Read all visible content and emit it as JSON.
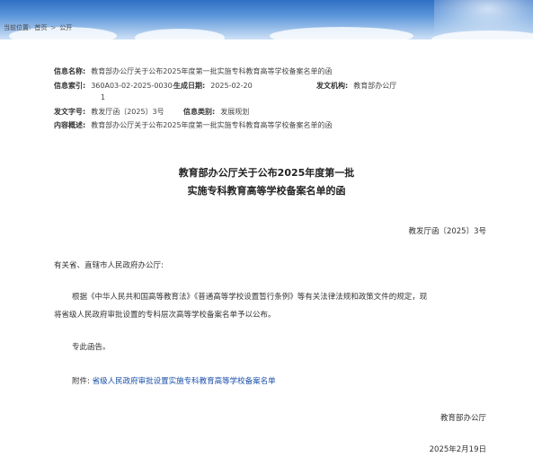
{
  "breadcrumb": {
    "label": "当前位置:",
    "home": "首页",
    "separator": ">",
    "current": "公开"
  },
  "meta": {
    "name_label": "信息名称:",
    "name_value": "教育部办公厅关于公布2025年度第一批实施专科教育高等学校备案名单的函",
    "index_label": "信息索引:",
    "index_value": "360A03-02-2025-0030-",
    "index_value_cont": "1",
    "date_label": "生成日期:",
    "date_value": "2025-02-20",
    "org_label": "发文机构:",
    "org_value": "教育部办公厅",
    "docnum_label": "发文字号:",
    "docnum_value": "教发厅函〔2025〕3号",
    "category_label": "信息类别:",
    "category_value": "发展规划",
    "summary_label": "内容概述:",
    "summary_value": "教育部办公厅关于公布2025年度第一批实施专科教育高等学校备案名单的函"
  },
  "doc": {
    "title_line1": "教育部办公厅关于公布2025年度第一批",
    "title_line2": "实施专科教育高等学校备案名单的函",
    "doc_number": "教发厅函〔2025〕3号",
    "addressee": "有关省、直辖市人民政府办公厅:",
    "body_line1": "根据《中华人民共和国高等教育法》《普通高等学校设置暂行条例》等有关法律法规和政策文件的规定，现",
    "body_line2": "将省级人民政府审批设置的专科层次高等学校备案名单予以公布。",
    "closing": "专此函告。",
    "attachment_label": "附件:",
    "attachment_link": "省级人民政府审批设置实施专科教育高等学校备案名单",
    "signer": "教育部办公厅",
    "date": "2025年2月19日"
  }
}
